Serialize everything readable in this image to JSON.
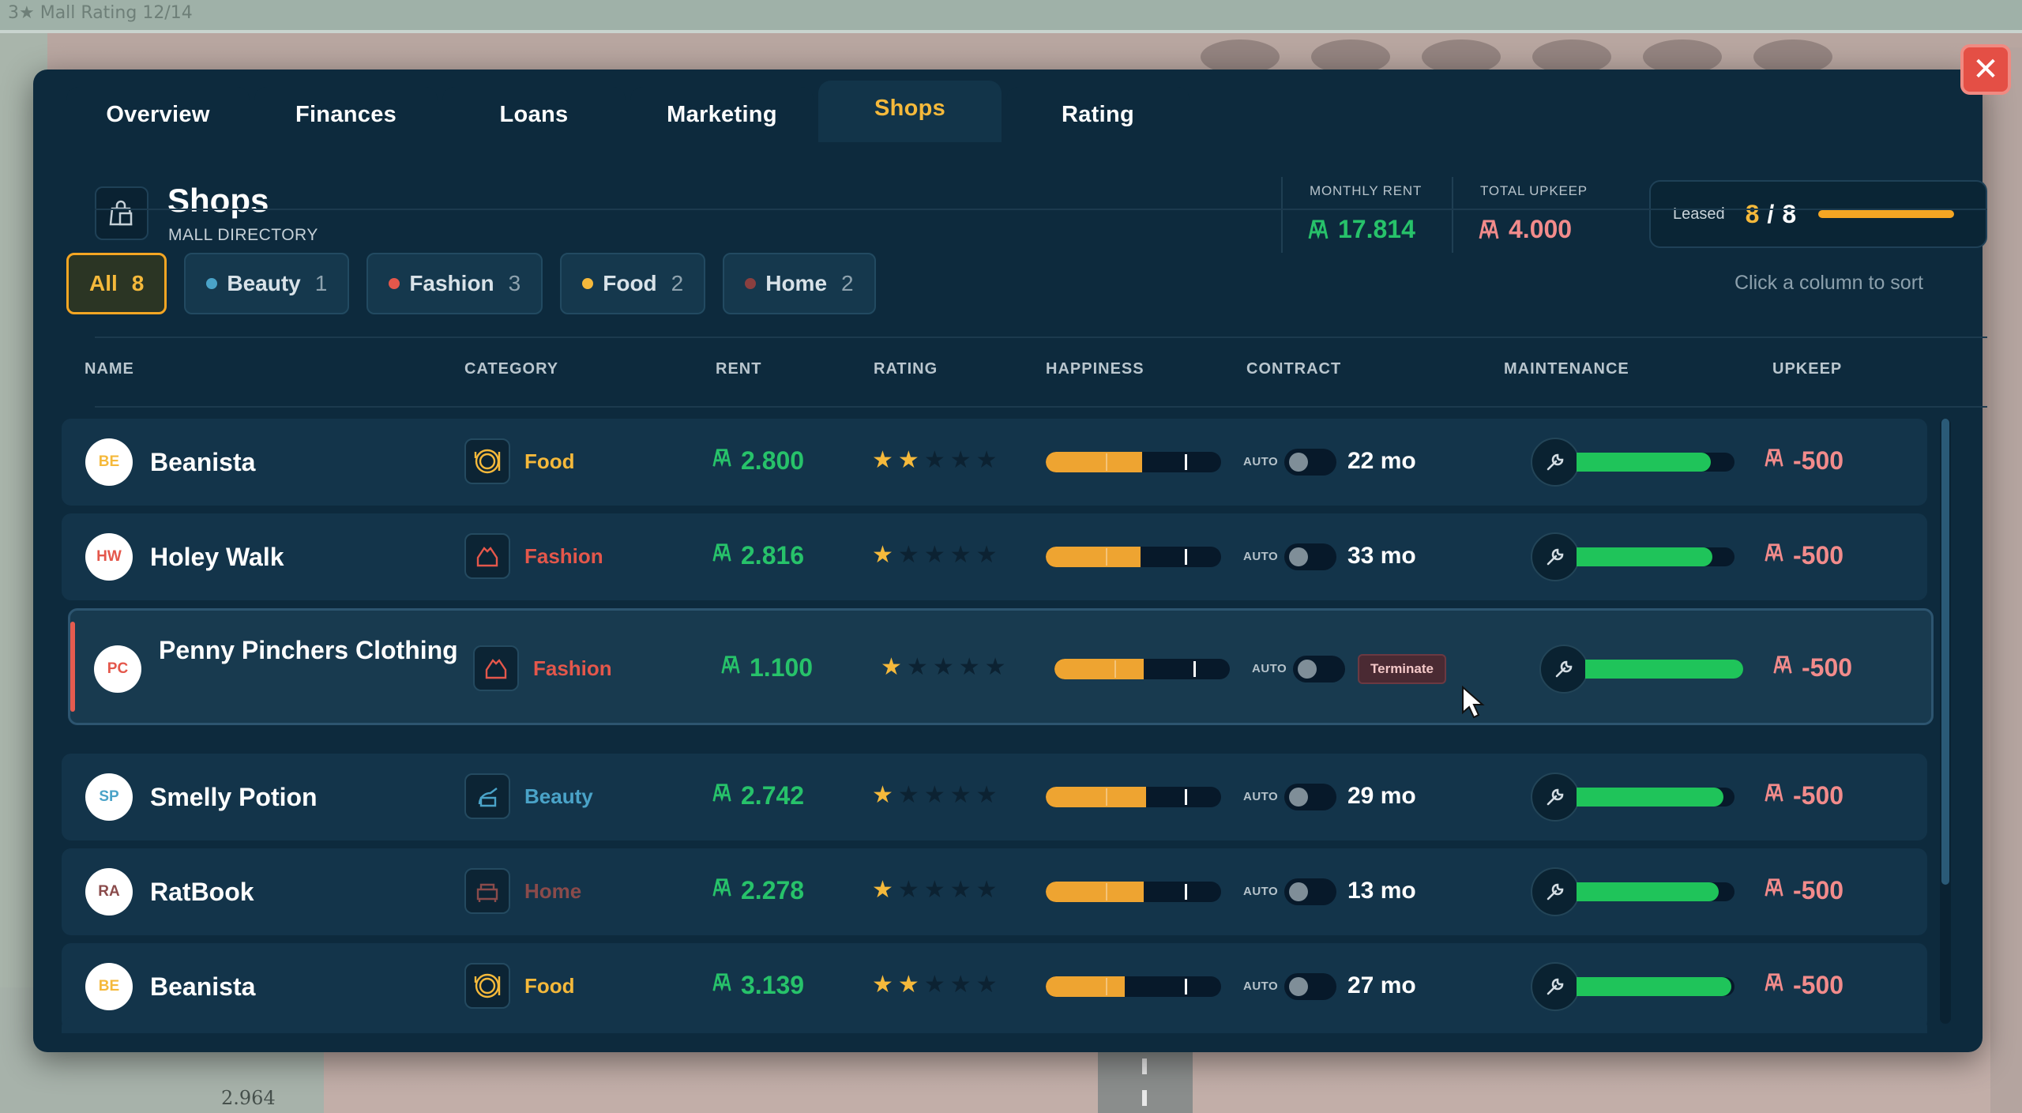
{
  "background": {
    "top_info": "3★ Mall Rating  12/14",
    "bottom_value": "2.964"
  },
  "tabs": [
    {
      "label": "Overview",
      "active": false
    },
    {
      "label": "Finances",
      "active": false
    },
    {
      "label": "Loans",
      "active": false
    },
    {
      "label": "Marketing",
      "active": false
    },
    {
      "label": "Shops",
      "active": true
    },
    {
      "label": "Rating",
      "active": false
    }
  ],
  "close_label": "✕",
  "header": {
    "title": "Shops",
    "subtitle": "MALL DIRECTORY",
    "monthly_rent_label": "MONTHLY RENT",
    "monthly_rent_value": "17.814",
    "total_upkeep_label": "TOTAL UPKEEP",
    "total_upkeep_value": "4.000",
    "leased_label": "Leased",
    "leased_count": "8",
    "leased_separator": "/",
    "leased_total": "8",
    "leased_fraction": 1.0
  },
  "filters": [
    {
      "label": "All",
      "count": "8",
      "active": true,
      "color": ""
    },
    {
      "label": "Beauty",
      "count": "1",
      "active": false,
      "color": "#4aa3c8"
    },
    {
      "label": "Fashion",
      "count": "3",
      "active": false,
      "color": "#e4574b"
    },
    {
      "label": "Food",
      "count": "2",
      "active": false,
      "color": "#f5b93b"
    },
    {
      "label": "Home",
      "count": "2",
      "active": false,
      "color": "#8a3f3f"
    }
  ],
  "sort_hint": "Click a column to sort",
  "columns": {
    "name": "NAME",
    "category": "CATEGORY",
    "rent": "RENT",
    "rating": "RATING",
    "happiness": "HAPPINESS",
    "contract": "CONTRACT",
    "maintenance": "MAINTENANCE",
    "upkeep": "UPKEEP"
  },
  "auto_label": "AUTO",
  "terminate_label": "Terminate",
  "category_colors": {
    "Food": "#f5b93b",
    "Fashion": "#e4574b",
    "Beauty": "#4aa3c8",
    "Home": "#8a4b4b"
  },
  "shops": [
    {
      "initials": "BE",
      "name": "Beanista",
      "category": "Food",
      "rent": "2.800",
      "rating": 2,
      "happiness": 0.55,
      "contract": "22 mo",
      "maintenance": 0.85,
      "upkeep": "-500"
    },
    {
      "initials": "HW",
      "name": "Holey Walk",
      "category": "Fashion",
      "rent": "2.816",
      "rating": 1,
      "happiness": 0.54,
      "contract": "33 mo",
      "maintenance": 0.86,
      "upkeep": "-500"
    },
    {
      "initials": "PC",
      "name": "Penny Pinchers Clothing",
      "category": "Fashion",
      "rent": "1.100",
      "rating": 1,
      "happiness": 0.51,
      "contract": "Terminate",
      "maintenance": 1.0,
      "upkeep": "-500",
      "selected": true
    },
    {
      "initials": "SP",
      "name": "Smelly Potion",
      "category": "Beauty",
      "rent": "2.742",
      "rating": 1,
      "happiness": 0.57,
      "contract": "29 mo",
      "maintenance": 0.93,
      "upkeep": "-500"
    },
    {
      "initials": "RA",
      "name": "RatBook",
      "category": "Home",
      "rent": "2.278",
      "rating": 1,
      "happiness": 0.56,
      "contract": "13 mo",
      "maintenance": 0.9,
      "upkeep": "-500"
    },
    {
      "initials": "BE",
      "name": "Beanista",
      "category": "Food",
      "rent": "3.139",
      "rating": 2,
      "happiness": 0.45,
      "contract": "27 mo",
      "maintenance": 0.98,
      "upkeep": "-500"
    }
  ]
}
